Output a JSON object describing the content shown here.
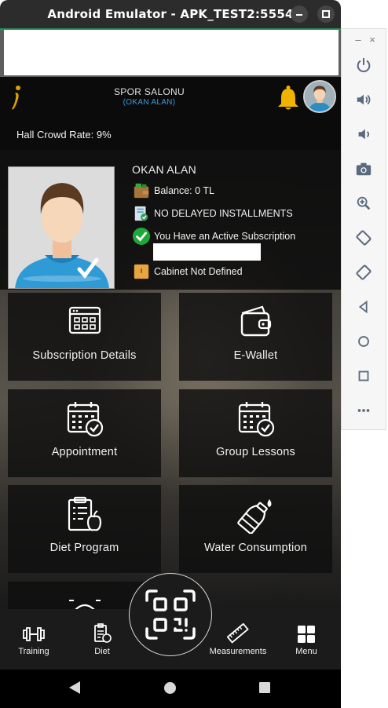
{
  "window": {
    "title": "Android Emulator - APK_TEST2:5554"
  },
  "side_panel": {
    "minimize_glyph": "–",
    "close_glyph": "×",
    "icons": [
      "power-icon",
      "volume-up-icon",
      "volume-down-icon",
      "camera-icon",
      "zoom-icon",
      "rotate-left-icon",
      "rotate-right-icon",
      "back-icon",
      "home-icon",
      "overview-icon",
      "more-icon"
    ]
  },
  "header": {
    "gym_name": "SPOR SALONU",
    "owner": "(OKAN ALAN)"
  },
  "crowd": {
    "text": "Hall Crowd Rate: 9%"
  },
  "profile": {
    "name": "OKAN ALAN",
    "balance": "Balance: 0 TL",
    "installments": "NO DELAYED INSTALLMENTS",
    "subscription": "You Have an Active Subscription",
    "cabinet": "Cabinet Not Defined"
  },
  "tiles": {
    "subscription": "Subscription Details",
    "wallet": "E-Wallet",
    "appointment": "Appointment",
    "group": "Group Lessons",
    "diet": "Diet Program",
    "water": "Water Consumption"
  },
  "nav": {
    "training": "Training",
    "diet": "Diet",
    "measurements": "Measurements",
    "menu": "Menu"
  },
  "colors": {
    "accent_blue": "#3a9ad9",
    "bell_gold": "#f0b400",
    "check_green": "#1fa83a",
    "background": "#0d0d0d"
  }
}
